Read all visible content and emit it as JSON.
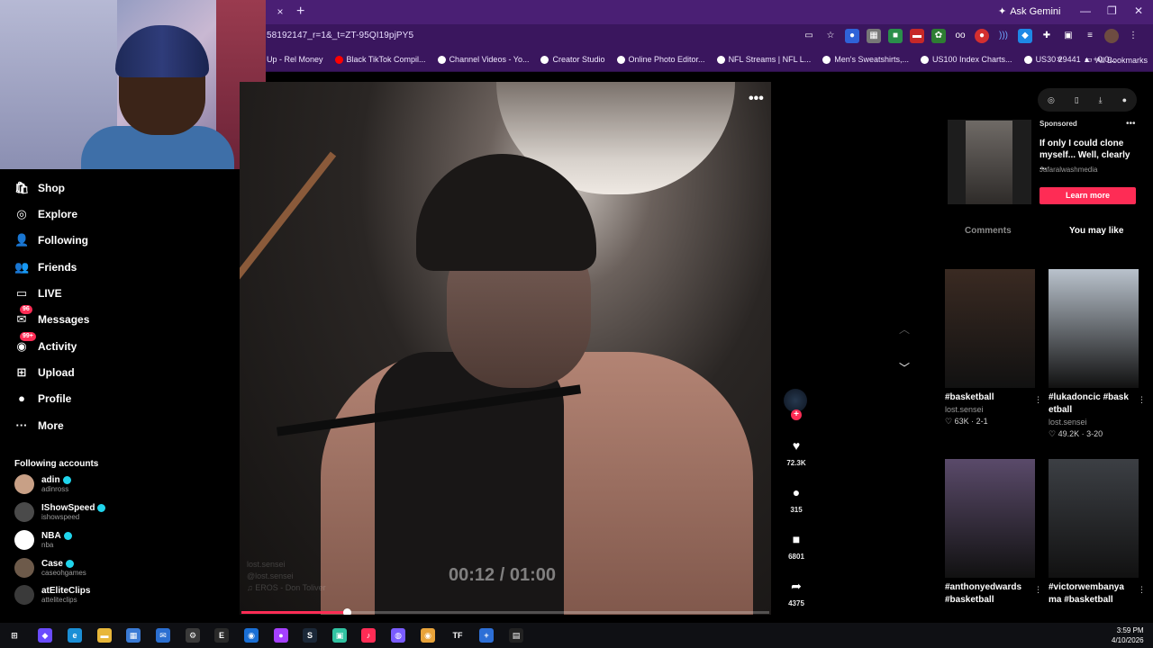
{
  "browser": {
    "tab_close": "×",
    "new_tab": "+",
    "ask_gemini": "Ask Gemini",
    "url": "58192147_r=1&_t=ZT-95QI19pjPY5",
    "window_controls": [
      "—",
      "❐",
      "✕"
    ],
    "bookmarks": [
      "Up - Rel Money",
      "Black TikTok Compil...",
      "Channel Videos - Yo...",
      "Creator Studio",
      "Online Photo Editor...",
      "NFL Streams | NFL L...",
      "Men's Sweatshirts,...",
      "US100 Index Charts...",
      "US30 29441 ▲ +0.0..."
    ],
    "all_bookmarks": "All Bookmarks",
    "bookmarks_overflow": "»"
  },
  "sidebar": {
    "items": [
      {
        "label": "Shop",
        "icon": "shop-icon",
        "glyph": "🛍"
      },
      {
        "label": "Explore",
        "icon": "compass-icon",
        "glyph": "◎"
      },
      {
        "label": "Following",
        "icon": "user-follow-icon",
        "glyph": "👤"
      },
      {
        "label": "Friends",
        "icon": "friends-icon",
        "glyph": "👥"
      },
      {
        "label": "LIVE",
        "icon": "live-icon",
        "glyph": "▭"
      },
      {
        "label": "Messages",
        "icon": "messages-icon",
        "glyph": "✉",
        "badge": "96"
      },
      {
        "label": "Activity",
        "icon": "activity-icon",
        "glyph": "◉",
        "badge": "99+"
      },
      {
        "label": "Upload",
        "icon": "upload-icon",
        "glyph": "⊞"
      },
      {
        "label": "Profile",
        "icon": "profile-icon",
        "glyph": "●"
      },
      {
        "label": "More",
        "icon": "more-icon",
        "glyph": "···"
      }
    ],
    "following_title": "Following accounts",
    "accounts": [
      {
        "name": "adin",
        "handle": "adinross",
        "verified": true,
        "color": "#c8a086"
      },
      {
        "name": "IShowSpeed",
        "handle": "ishowspeed",
        "verified": true,
        "color": "#4a4a4a"
      },
      {
        "name": "NBA",
        "handle": "nba",
        "verified": true,
        "color": "#ffffff"
      },
      {
        "name": "Case",
        "handle": "caseohgames",
        "verified": true,
        "color": "#6d5a4a"
      },
      {
        "name": "atEliteClips",
        "handle": "atteliteclips",
        "verified": false,
        "color": "#3a3a3a"
      }
    ]
  },
  "video": {
    "more": "•••",
    "time": "00:12 / 01:00",
    "progress": 0.2,
    "caption_user": "lost.sensei",
    "caption_line2": "@lost.sensei",
    "caption_line3": "♫ EROS - Don Toliver"
  },
  "actions": {
    "likes": "72.3K",
    "comments": "315",
    "saves": "6801",
    "shares": "4375",
    "plus": "+",
    "up": "︿",
    "down": "﹀"
  },
  "right_panel": {
    "tools": [
      "◎",
      "▯",
      "⤓",
      "●"
    ],
    "ad": {
      "sponsored": "Sponsored",
      "more": "•••",
      "text": "If only I could clone myself... Well, clearly ...",
      "advertiser": "Jafaralwashmedia",
      "cta": "Learn more"
    },
    "tabs": [
      "Comments",
      "You may like"
    ],
    "cards": [
      {
        "title": "#basketball",
        "user": "lost.sensei",
        "stats": "♡ 63K · 2-1",
        "color": "#3a2a22"
      },
      {
        "title": "#lukadoncic #basketball",
        "user": "lost.sensei",
        "stats": "♡ 49.2K · 3-20",
        "color": "#b9c2cc"
      },
      {
        "title": "#anthonyedwards #basketball",
        "user": "",
        "stats": "",
        "color": "#5a4a6a"
      },
      {
        "title": "#victorwembanyama #basketball",
        "user": "",
        "stats": "",
        "color": "#3c3f44"
      }
    ],
    "card_dots": "⋮"
  },
  "taskbar": {
    "time": "3:59 PM",
    "date": "4/10/2026",
    "apps": [
      {
        "icon": "windows-start-icon",
        "glyph": "⊞",
        "color": "#0f1014"
      },
      {
        "icon": "copilot-icon",
        "glyph": "◆",
        "color": "#6a4cff"
      },
      {
        "icon": "edge-icon",
        "glyph": "e",
        "color": "#1b8fd6"
      },
      {
        "icon": "file-explorer-icon",
        "glyph": "▬",
        "color": "#e8b73a"
      },
      {
        "icon": "store-icon",
        "glyph": "▦",
        "color": "#3a7bd5"
      },
      {
        "icon": "mail-icon",
        "glyph": "✉",
        "color": "#2b6fd1"
      },
      {
        "icon": "settings-icon",
        "glyph": "⚙",
        "color": "#3a3a3a"
      },
      {
        "icon": "epic-games-icon",
        "glyph": "E",
        "color": "#2a2a2a"
      },
      {
        "icon": "steam-like-icon",
        "glyph": "◉",
        "color": "#1a6fd5"
      },
      {
        "icon": "messenger-icon",
        "glyph": "●",
        "color": "#a540ff"
      },
      {
        "icon": "steam-icon",
        "glyph": "S",
        "color": "#1b2838"
      },
      {
        "icon": "streamlabs-icon",
        "glyph": "▣",
        "color": "#31c3a2"
      },
      {
        "icon": "tiktok-icon",
        "glyph": "♪",
        "color": "#fe2c55"
      },
      {
        "icon": "app-purple-icon",
        "glyph": "◍",
        "color": "#7a5cff"
      },
      {
        "icon": "chrome-icon",
        "glyph": "◉",
        "color": "#e8a33a"
      },
      {
        "icon": "tf-icon",
        "glyph": "TF",
        "color": "#0f1014"
      },
      {
        "icon": "plus-app-icon",
        "glyph": "+",
        "color": "#2d6fd6"
      },
      {
        "icon": "capcut-icon",
        "glyph": "▤",
        "color": "#222"
      }
    ]
  }
}
